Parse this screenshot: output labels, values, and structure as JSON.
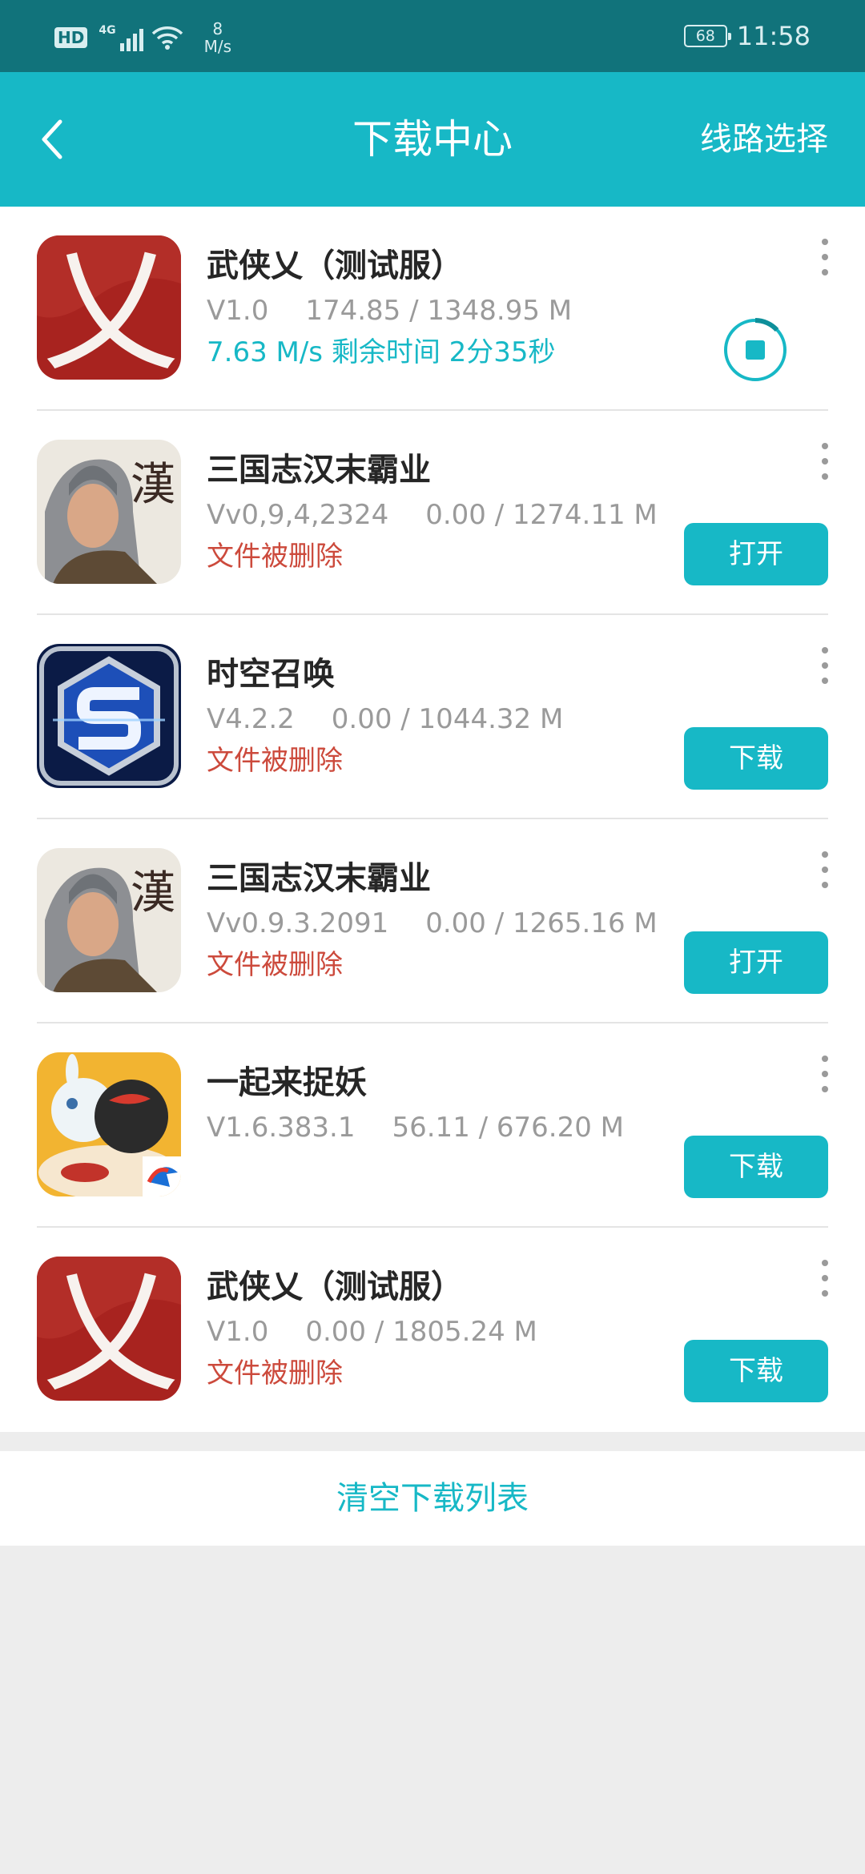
{
  "status_bar": {
    "hd": "HD",
    "network_gen": "4G",
    "net_speed_value": "8",
    "net_speed_unit": "M/s",
    "battery": "68",
    "time": "11:58"
  },
  "header": {
    "title": "下载中心",
    "route_label": "线路选择",
    "back_icon": "chevron-left-icon"
  },
  "items": [
    {
      "name": "武侠乂（测试服）",
      "version": "V1.0",
      "size": "174.85 / 1348.95 M",
      "status": "7.63 M/s  剩余时间 2分35秒",
      "status_type": "downloading",
      "action": "stop",
      "action_label": "",
      "progress": 0.13
    },
    {
      "name": "三国志汉末霸业",
      "version": "Vv0,9,4,2324",
      "size": "0.00 / 1274.11 M",
      "status": "文件被删除",
      "status_type": "deleted",
      "action": "open",
      "action_label": "打开"
    },
    {
      "name": "时空召唤",
      "version": "V4.2.2",
      "size": "0.00 / 1044.32 M",
      "status": "文件被删除",
      "status_type": "deleted",
      "action": "download",
      "action_label": "下载"
    },
    {
      "name": "三国志汉末霸业",
      "version": "Vv0.9.3.2091",
      "size": "0.00 / 1265.16 M",
      "status": "文件被删除",
      "status_type": "deleted",
      "action": "open",
      "action_label": "打开"
    },
    {
      "name": "一起来捉妖",
      "version": "V1.6.383.1",
      "size": "56.11 / 676.20 M",
      "status": "",
      "status_type": "none",
      "action": "download",
      "action_label": "下载"
    },
    {
      "name": "武侠乂（测试服）",
      "version": "V1.0",
      "size": "0.00 / 1805.24 M",
      "status": "文件被删除",
      "status_type": "deleted",
      "action": "download",
      "action_label": "下载"
    }
  ],
  "icon_text": {
    "wuxia": "乂",
    "sanguo": "漢"
  },
  "clear_label": "清空下载列表",
  "colors": {
    "accent": "#17b8c6",
    "status_bar": "#11737b",
    "deleted": "#cc4a3c",
    "meta": "#9a9a9a"
  }
}
